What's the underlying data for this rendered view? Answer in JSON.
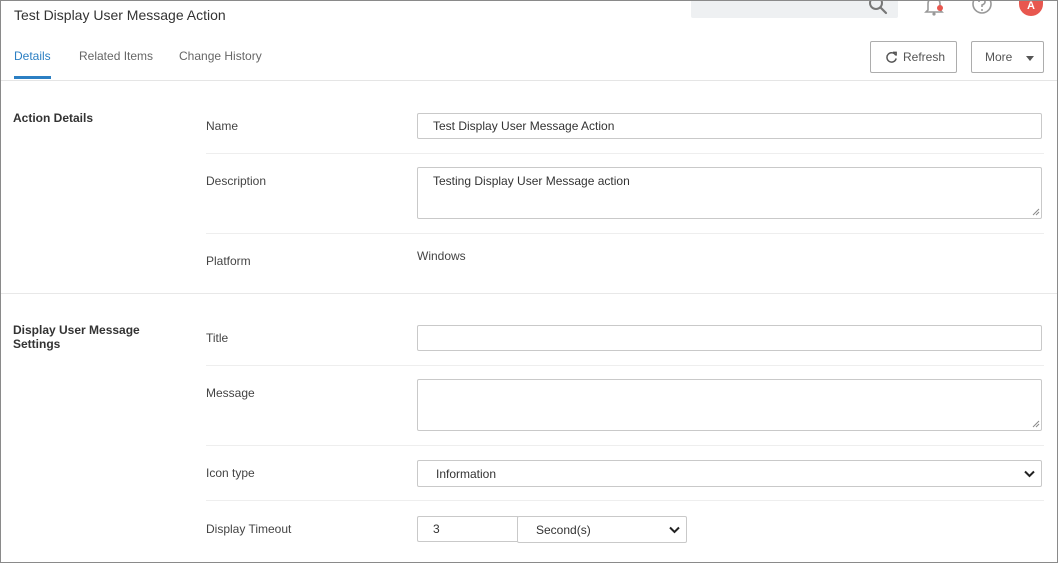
{
  "page": {
    "title": "Test Display User Message Action"
  },
  "topbar": {
    "search_icon": "search-icon",
    "notification_icon": "bell-icon",
    "help_icon": "help-icon",
    "avatar_initial": "A",
    "avatar_color": "#e8574f"
  },
  "tabs": [
    {
      "label": "Details",
      "active": true
    },
    {
      "label": "Related Items",
      "active": false
    },
    {
      "label": "Change History",
      "active": false
    }
  ],
  "toolbar": {
    "refresh_label": "Refresh",
    "more_label": "More"
  },
  "action_details": {
    "section_label": "Action Details",
    "name_label": "Name",
    "name_value": "Test Display User Message Action",
    "description_label": "Description",
    "description_value": "Testing Display User Message action",
    "platform_label": "Platform",
    "platform_value": "Windows"
  },
  "message_settings": {
    "section_label_line1": "Display User Message",
    "section_label_line2": "Settings",
    "title_label": "Title",
    "title_value": "",
    "message_label": "Message",
    "message_value": "",
    "icon_type_label": "Icon type",
    "icon_type_value": "Information",
    "timeout_label": "Display Timeout",
    "timeout_value": "3",
    "timeout_unit": "Second(s)"
  },
  "colors": {
    "accent": "#2b7fc3",
    "border": "#c9c9c9"
  }
}
